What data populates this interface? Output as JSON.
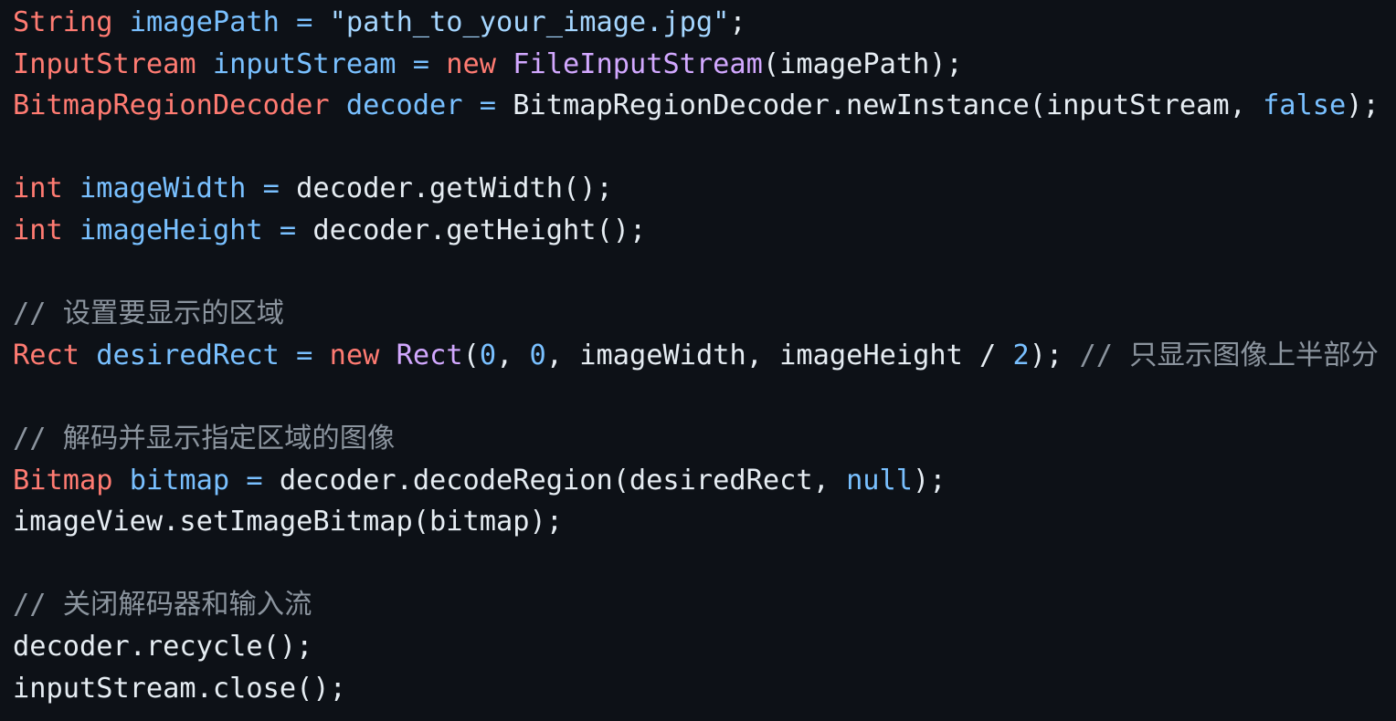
{
  "colors": {
    "background": "#0d1117",
    "plain": "#e6edf3",
    "keyword": "#ff7b72",
    "identifier": "#79c0ff",
    "string": "#a5d6ff",
    "class_name": "#d2a8ff",
    "comment": "#8b949e"
  },
  "code": {
    "language": "java",
    "lines": [
      [
        {
          "t": "String",
          "k": "keyword"
        },
        {
          "t": " ",
          "k": "plain"
        },
        {
          "t": "imagePath",
          "k": "identifier"
        },
        {
          "t": " = ",
          "k": "identifier"
        },
        {
          "t": "\"path_to_your_image.jpg\"",
          "k": "string"
        },
        {
          "t": ";",
          "k": "plain"
        }
      ],
      [
        {
          "t": "InputStream",
          "k": "keyword"
        },
        {
          "t": " ",
          "k": "plain"
        },
        {
          "t": "inputStream",
          "k": "identifier"
        },
        {
          "t": " = ",
          "k": "identifier"
        },
        {
          "t": "new",
          "k": "keyword"
        },
        {
          "t": " ",
          "k": "plain"
        },
        {
          "t": "FileInputStream",
          "k": "class_name"
        },
        {
          "t": "(imagePath);",
          "k": "plain"
        }
      ],
      [
        {
          "t": "BitmapRegionDecoder",
          "k": "keyword"
        },
        {
          "t": " ",
          "k": "plain"
        },
        {
          "t": "decoder",
          "k": "identifier"
        },
        {
          "t": " = ",
          "k": "identifier"
        },
        {
          "t": "BitmapRegionDecoder.newInstance(inputStream, ",
          "k": "plain"
        },
        {
          "t": "false",
          "k": "identifier"
        },
        {
          "t": ");",
          "k": "plain"
        }
      ],
      [],
      [
        {
          "t": "int",
          "k": "keyword"
        },
        {
          "t": " ",
          "k": "plain"
        },
        {
          "t": "imageWidth",
          "k": "identifier"
        },
        {
          "t": " = ",
          "k": "identifier"
        },
        {
          "t": "decoder.getWidth();",
          "k": "plain"
        }
      ],
      [
        {
          "t": "int",
          "k": "keyword"
        },
        {
          "t": " ",
          "k": "plain"
        },
        {
          "t": "imageHeight",
          "k": "identifier"
        },
        {
          "t": " = ",
          "k": "identifier"
        },
        {
          "t": "decoder.getHeight();",
          "k": "plain"
        }
      ],
      [],
      [
        {
          "t": "// 设置要显示的区域",
          "k": "comment"
        }
      ],
      [
        {
          "t": "Rect",
          "k": "keyword"
        },
        {
          "t": " ",
          "k": "plain"
        },
        {
          "t": "desiredRect",
          "k": "identifier"
        },
        {
          "t": " = ",
          "k": "identifier"
        },
        {
          "t": "new",
          "k": "keyword"
        },
        {
          "t": " ",
          "k": "plain"
        },
        {
          "t": "Rect",
          "k": "class_name"
        },
        {
          "t": "(",
          "k": "plain"
        },
        {
          "t": "0",
          "k": "identifier"
        },
        {
          "t": ", ",
          "k": "plain"
        },
        {
          "t": "0",
          "k": "identifier"
        },
        {
          "t": ", imageWidth, imageHeight / ",
          "k": "plain"
        },
        {
          "t": "2",
          "k": "identifier"
        },
        {
          "t": "); ",
          "k": "plain"
        },
        {
          "t": "// 只显示图像上半部分",
          "k": "comment"
        }
      ],
      [],
      [
        {
          "t": "// 解码并显示指定区域的图像",
          "k": "comment"
        }
      ],
      [
        {
          "t": "Bitmap",
          "k": "keyword"
        },
        {
          "t": " ",
          "k": "plain"
        },
        {
          "t": "bitmap",
          "k": "identifier"
        },
        {
          "t": " = ",
          "k": "identifier"
        },
        {
          "t": "decoder.decodeRegion(desiredRect, ",
          "k": "plain"
        },
        {
          "t": "null",
          "k": "identifier"
        },
        {
          "t": ");",
          "k": "plain"
        }
      ],
      [
        {
          "t": "imageView.setImageBitmap(bitmap);",
          "k": "plain"
        }
      ],
      [],
      [
        {
          "t": "// 关闭解码器和输入流",
          "k": "comment"
        }
      ],
      [
        {
          "t": "decoder.recycle();",
          "k": "plain"
        }
      ],
      [
        {
          "t": "inputStream.close();",
          "k": "plain"
        }
      ]
    ]
  }
}
